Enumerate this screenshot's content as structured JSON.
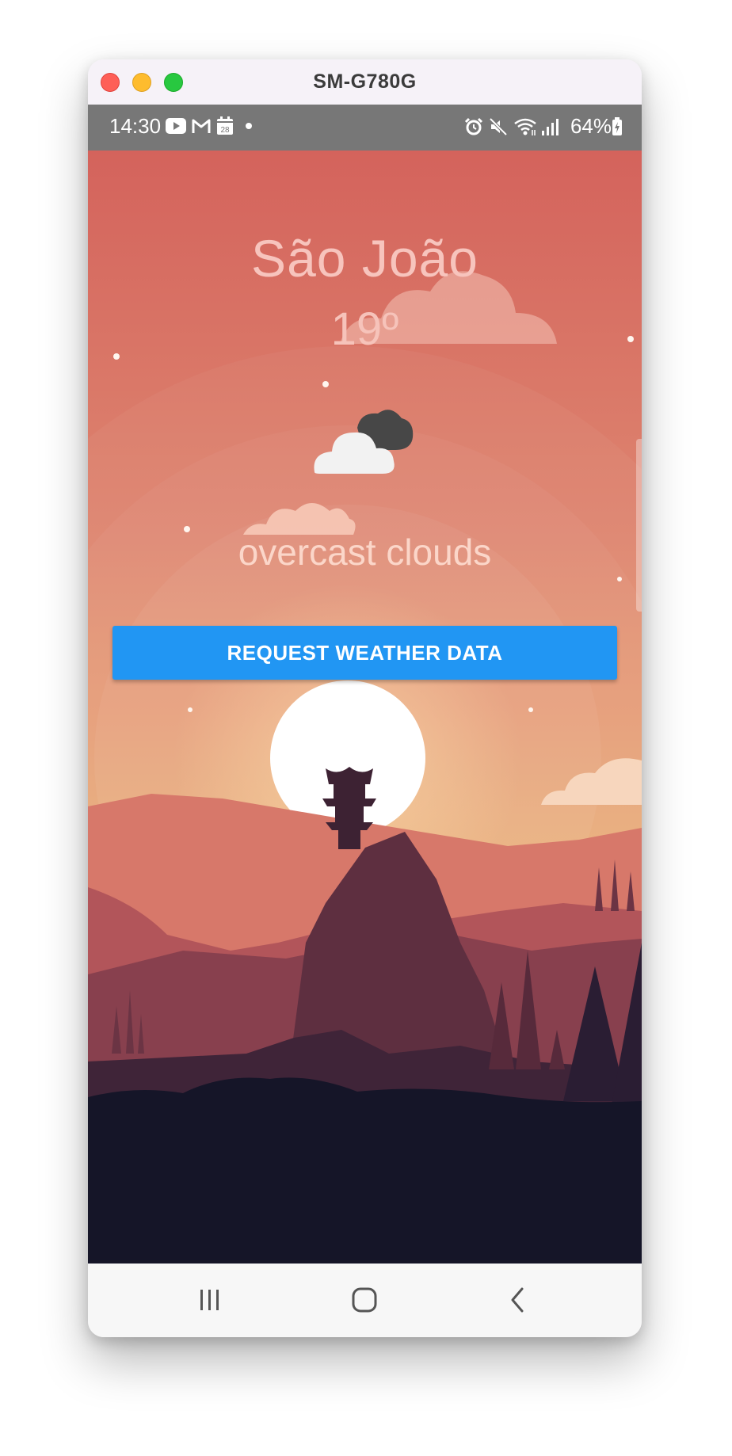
{
  "window": {
    "title": "SM-G780G"
  },
  "status_bar": {
    "time": "14:30",
    "calendar_day": "28",
    "battery": "64%",
    "left_icons": [
      "youtube-icon",
      "gmail-icon",
      "calendar-icon",
      "notification-dot-icon"
    ],
    "right_icons": [
      "alarm-icon",
      "mute-icon",
      "wifi-icon",
      "signal-icon",
      "battery-icon"
    ]
  },
  "weather": {
    "city": "São João",
    "temperature": "19º",
    "description": "overcast clouds",
    "icon": "overcast-clouds-icon"
  },
  "actions": {
    "request_label": "REQUEST WEATHER DATA"
  },
  "navigation": {
    "icons": [
      "recent-apps-icon",
      "home-icon",
      "back-icon"
    ]
  },
  "colors": {
    "button": "#2196f3",
    "status_bar": "#777777",
    "sky_top": "#d4635c",
    "sky_bottom": "#efb86f",
    "ground": "#151528"
  }
}
